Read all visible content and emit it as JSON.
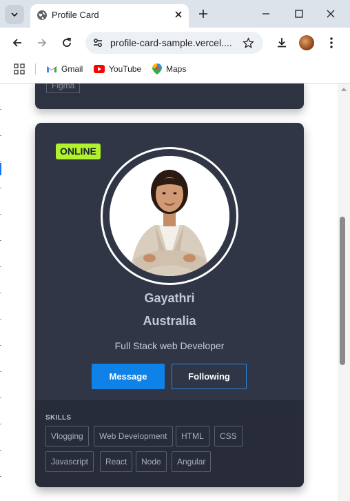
{
  "browser": {
    "tab_title": "Profile Card",
    "url": "profile-card-sample.vercel....",
    "bookmarks": [
      {
        "label": "Gmail",
        "icon": "gmail-icon"
      },
      {
        "label": "YouTube",
        "icon": "youtube-icon"
      },
      {
        "label": "Maps",
        "icon": "maps-icon"
      }
    ]
  },
  "previous_card": {
    "partial_tag": "Figma"
  },
  "card": {
    "status": "ONLINE",
    "name": "Gayathri",
    "location": "Australia",
    "job": "Full Stack web Developer",
    "buttons": {
      "message": "Message",
      "following": "Following"
    },
    "skills_title": "SKILLS",
    "skills": [
      "Vlogging",
      "Web Development",
      "HTML",
      "CSS",
      "Javascript",
      "React",
      "Node",
      "Angular"
    ]
  },
  "colors": {
    "card_bg": "#303645",
    "skills_bg": "#272c38",
    "online_badge": "#b2f22c",
    "primary_button": "#0f82e8"
  }
}
